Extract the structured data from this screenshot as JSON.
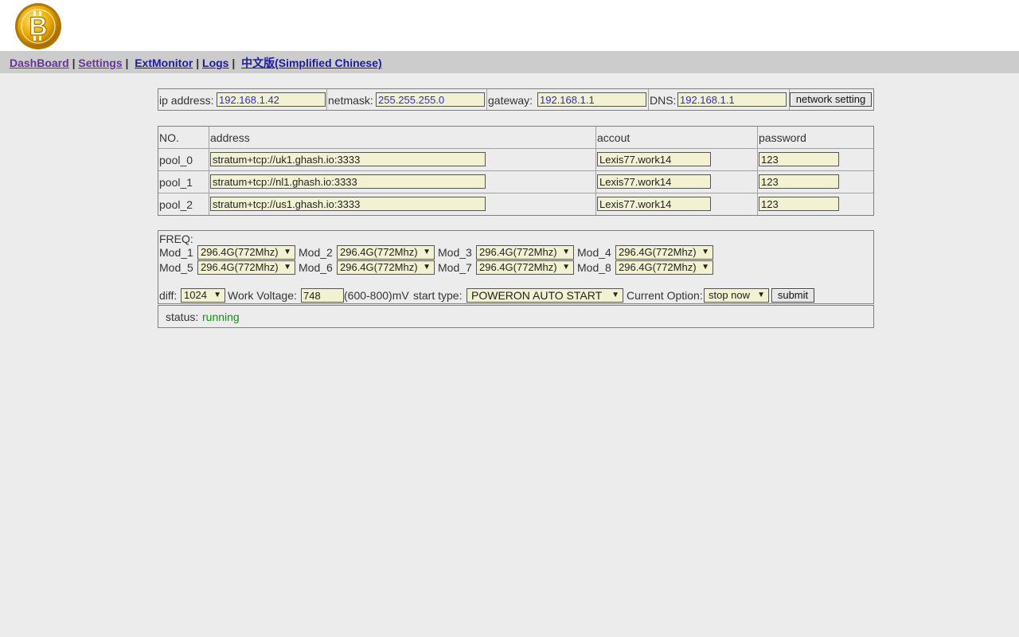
{
  "nav": {
    "links": [
      "DashBoard",
      "Settings",
      "ExtMonitor",
      "Logs",
      "中文版(Simplified Chinese)"
    ],
    "separator": "|"
  },
  "network": {
    "ip_label": "ip address:",
    "ip_value": "192.168.1.42",
    "netmask_label": "netmask:",
    "netmask_value": "255.255.255.0",
    "gateway_label": "gateway:",
    "gateway_value": "192.168.1.1",
    "dns_label": "DNS:",
    "dns_value": "192.168.1.1",
    "button": "network setting"
  },
  "pools": {
    "headers": [
      "NO.",
      "address",
      "accout",
      "password"
    ],
    "rows": [
      {
        "no": "pool_0",
        "address": "stratum+tcp://uk1.ghash.io:3333",
        "account": "Lexis77.work14",
        "password": "123"
      },
      {
        "no": "pool_1",
        "address": "stratum+tcp://nl1.ghash.io:3333",
        "account": "Lexis77.work14",
        "password": "123"
      },
      {
        "no": "pool_2",
        "address": "stratum+tcp://us1.ghash.io:3333",
        "account": "Lexis77.work14",
        "password": "123"
      }
    ]
  },
  "freq": {
    "label": "FREQ:",
    "mods": [
      {
        "name": "Mod_1",
        "value": "296.4G(772Mhz)"
      },
      {
        "name": "Mod_2",
        "value": "296.4G(772Mhz)"
      },
      {
        "name": "Mod_3",
        "value": "296.4G(772Mhz)"
      },
      {
        "name": "Mod_4",
        "value": "296.4G(772Mhz)"
      },
      {
        "name": "Mod_5",
        "value": "296.4G(772Mhz)"
      },
      {
        "name": "Mod_6",
        "value": "296.4G(772Mhz)"
      },
      {
        "name": "Mod_7",
        "value": "296.4G(772Mhz)"
      },
      {
        "name": "Mod_8",
        "value": "296.4G(772Mhz)"
      }
    ],
    "diff_label": "diff:",
    "diff_value": "1024",
    "voltage_label": "Work Voltage:",
    "voltage_value": "748",
    "voltage_range": "(600-800)mV",
    "start_type_label": "start type:",
    "start_type_value": "POWERON AUTO START",
    "current_option_label": "Current Option:",
    "current_option_value": "stop now",
    "submit": "submit"
  },
  "status": {
    "label": "status:",
    "value": "running"
  },
  "colors": {
    "running": "#1a8a1a",
    "link": "#1a1aa6",
    "visited": "#663399"
  }
}
